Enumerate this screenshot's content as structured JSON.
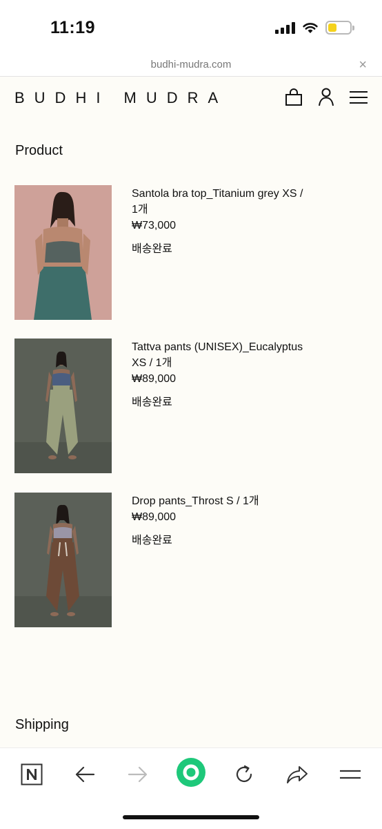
{
  "status_bar": {
    "time": "11:19"
  },
  "browser": {
    "url": "budhi-mudra.com",
    "close_glyph": "×"
  },
  "site": {
    "logo": "BUDHI MUDRA"
  },
  "sections": {
    "product_title": "Product",
    "shipping_title": "Shipping"
  },
  "products": [
    {
      "line1": "Santola bra top_Titanium grey XS /",
      "line2": "1개",
      "price": "₩73,000",
      "status": "배송완료"
    },
    {
      "line1": "Tattva pants (UNISEX)_Eucalyptus",
      "line2": "XS / 1개",
      "price": "₩89,000",
      "status": "배송완료"
    },
    {
      "line1": "Drop pants_Throst S / 1개",
      "line2": "",
      "price": "₩89,000",
      "status": "배송완료"
    }
  ],
  "colors": {
    "accent": "#1ec87a",
    "background": "#fdfcf7"
  },
  "icons": {
    "header": [
      "bag-icon",
      "user-icon",
      "menu-icon"
    ],
    "toolbar": [
      "naver-logo-icon",
      "back-arrow-icon",
      "forward-arrow-icon",
      "green-home-icon",
      "refresh-icon",
      "share-icon",
      "menu-icon"
    ]
  }
}
